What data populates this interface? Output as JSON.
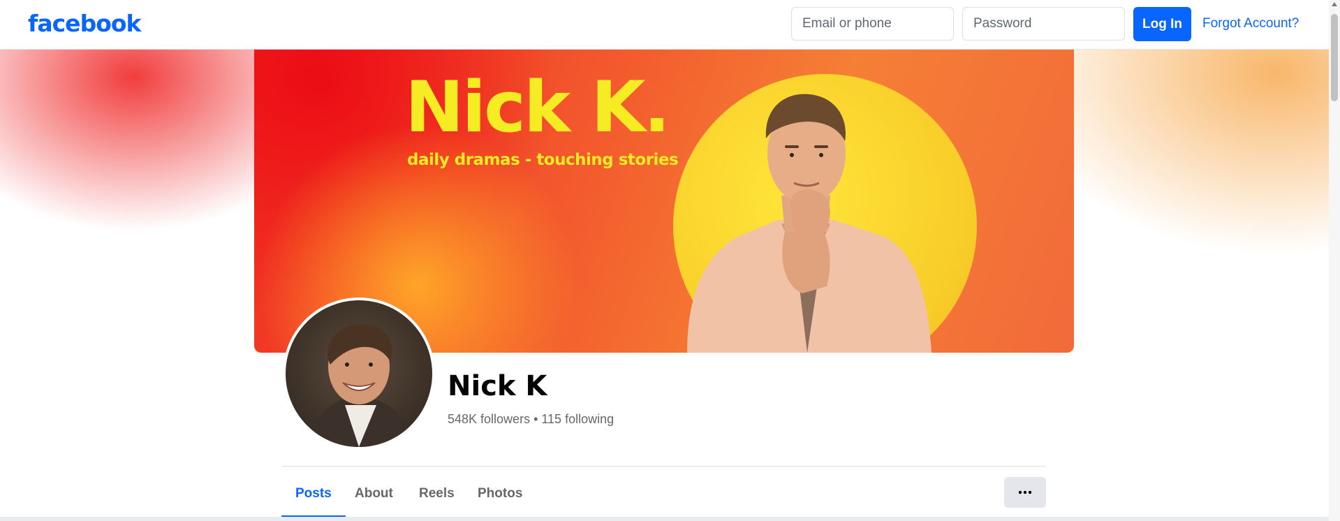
{
  "header": {
    "logo": "facebook",
    "email_placeholder": "Email or phone",
    "password_placeholder": "Password",
    "login_label": "Log In",
    "forgot_label": "Forgot Account?"
  },
  "cover": {
    "title": "Nick K.",
    "subtitle": "daily dramas  - touching stories"
  },
  "profile": {
    "name": "Nick K",
    "stats": "548K followers • 115 following"
  },
  "tabs": [
    {
      "label": "Posts",
      "active": true
    },
    {
      "label": "About",
      "active": false
    },
    {
      "label": "Reels",
      "active": false
    },
    {
      "label": "Photos",
      "active": false
    }
  ],
  "more_button": {
    "icon": "more-horizontal-icon"
  },
  "colors": {
    "brand_blue": "#0866ff",
    "cover_red": "#f02a22",
    "cover_orange": "#f57f35",
    "cover_yellow_text": "#f6ec24",
    "sun_yellow": "#f8cc28"
  }
}
